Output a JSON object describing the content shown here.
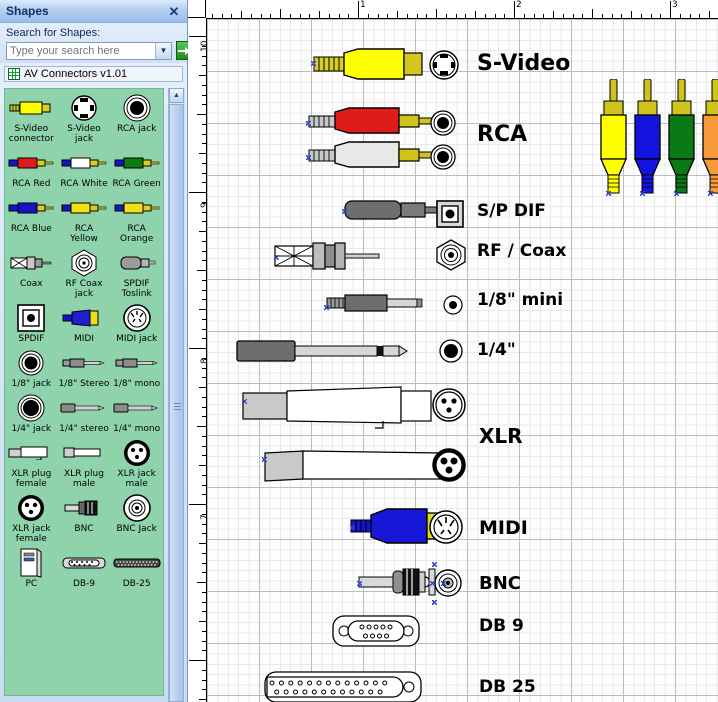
{
  "panel": {
    "title": "Shapes",
    "close_icon": "close-icon",
    "search_label": "Search for Shapes:",
    "search_value": "",
    "search_placeholder": "Type your search here",
    "dropdown_icon": "chevron-down-icon",
    "go_icon": "arrow-right-icon",
    "stencil_name": "AV Connectors v1.01",
    "stencil_icon": "stencil-grid-icon",
    "scroll_up_icon": "chevron-up-icon",
    "bg_color": "#8fd3ad"
  },
  "gallery": {
    "items": [
      {
        "label": "S-Video\nconnector",
        "art": "svideo-plug"
      },
      {
        "label": "S-Video\njack",
        "art": "svideo-jack"
      },
      {
        "label": "RCA jack",
        "art": "rca-jack"
      },
      {
        "label": "RCA Red",
        "art": "rca-plug",
        "color": "#e01b1b"
      },
      {
        "label": "RCA White",
        "art": "rca-plug",
        "color": "#ffffff"
      },
      {
        "label": "RCA Green",
        "art": "rca-plug",
        "color": "#107c10"
      },
      {
        "label": "RCA Blue",
        "art": "rca-plug",
        "color": "#1414c8"
      },
      {
        "label": "RCA\nYellow",
        "art": "rca-plug",
        "color": "#f2e014"
      },
      {
        "label": "RCA\nOrange",
        "art": "rca-plug",
        "color": "#f2e014"
      },
      {
        "label": "Coax",
        "art": "coax-plug"
      },
      {
        "label": "RF Coax\njack",
        "art": "rf-coax-jack"
      },
      {
        "label": "SPDIF\nToslink",
        "art": "toslink-plug"
      },
      {
        "label": "SPDIF",
        "art": "spdif-jack"
      },
      {
        "label": "MIDI",
        "art": "midi-plug",
        "color": "#1414c8"
      },
      {
        "label": "MIDI jack",
        "art": "midi-jack"
      },
      {
        "label": "1/8\" jack",
        "art": "round-jack"
      },
      {
        "label": "1/8\" Stereo",
        "art": "mini-plug"
      },
      {
        "label": "1/8\" mono",
        "art": "mini-plug"
      },
      {
        "label": "1/4\" jack",
        "art": "round-jack-lg"
      },
      {
        "label": "1/4\" stereo",
        "art": "quarter-plug"
      },
      {
        "label": "1/4\" mono",
        "art": "quarter-plug"
      },
      {
        "label": "XLR plug\nfemale",
        "art": "xlr-plug-f"
      },
      {
        "label": "XLR plug\nmale",
        "art": "xlr-plug-m"
      },
      {
        "label": "XLR jack\nmale",
        "art": "xlr-jack-m"
      },
      {
        "label": "XLR jack\nfemale",
        "art": "xlr-jack-f"
      },
      {
        "label": "BNC",
        "art": "bnc-plug"
      },
      {
        "label": "BNC Jack",
        "art": "bnc-jack"
      },
      {
        "label": "PC",
        "art": "pc-tower"
      },
      {
        "label": "DB-9",
        "art": "db9"
      },
      {
        "label": "DB-25",
        "art": "db25"
      }
    ]
  },
  "canvas": {
    "ruler_h_numbers": [
      "1",
      "2",
      "3"
    ],
    "ruler_v_numbers": [
      "10",
      "9",
      "8",
      "7"
    ],
    "rows": [
      {
        "label": "S-Video",
        "art": "svideo",
        "size": 22
      },
      {
        "label": "RCA",
        "art": "rca",
        "size": 22
      },
      {
        "label": "S/P DIF",
        "art": "spdif",
        "size": 17
      },
      {
        "label": "RF / Coax",
        "art": "rfcoax",
        "size": 17
      },
      {
        "label": "1/8\" mini",
        "art": "mini",
        "size": 17
      },
      {
        "label": "1/4\"",
        "art": "quarter",
        "size": 17
      },
      {
        "label": "XLR",
        "art": "xlr",
        "size": 20
      },
      {
        "label": "MIDI",
        "art": "midi",
        "size": 19
      },
      {
        "label": "BNC",
        "art": "bnc",
        "size": 18
      },
      {
        "label": "DB 9",
        "art": "db9",
        "size": 17
      },
      {
        "label": "DB 25",
        "art": "db25",
        "size": 17
      }
    ],
    "rca_color_plugs": [
      {
        "name": "yellow-rca-plug",
        "color": "#ffff00"
      },
      {
        "name": "blue-rca-plug",
        "color": "#1414e0"
      },
      {
        "name": "green-rca-plug",
        "color": "#0a7a15"
      },
      {
        "name": "orange-rca-plug",
        "color": "#f79a3c"
      }
    ],
    "plug_metal_color": "#cfc41a",
    "grid_color": "#d9d9d9"
  }
}
